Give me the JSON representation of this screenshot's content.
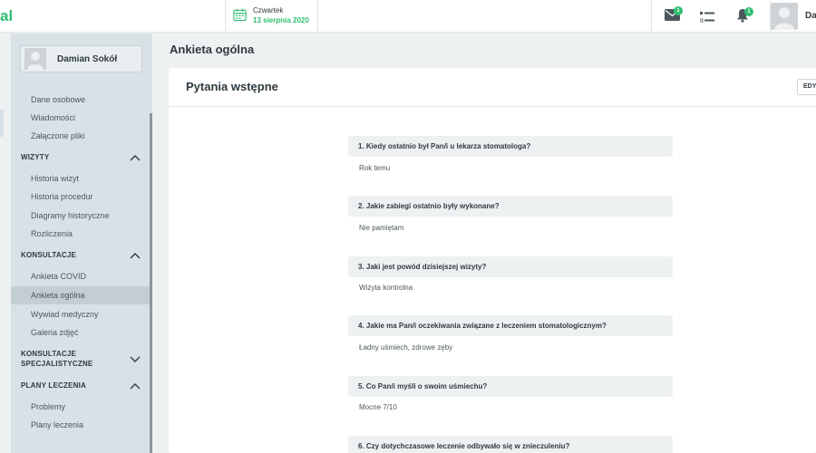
{
  "app": {
    "logo_text": "al"
  },
  "topbar": {
    "date_day": "Czwartek",
    "date_full": "13 sierpnia 2020",
    "mail_badge": "1",
    "bell_badge": "1",
    "user_name_partial": "Da"
  },
  "sidebar": {
    "profile_name": "Damian Sokół",
    "top_items": [
      "Dane osobowe",
      "Wiadomości",
      "Załączone pliki"
    ],
    "sections": [
      {
        "title": "WIZYTY",
        "expanded": true,
        "items": [
          "Historia wizyt",
          "Historia procedur",
          "Diagramy historyczne",
          "Rozliczenia"
        ]
      },
      {
        "title": "KONSULTACJE",
        "expanded": true,
        "items": [
          "Ankieta COVID",
          "Ankieta ogólna",
          "Wywiad medyczny",
          "Galeria zdjęć"
        ]
      },
      {
        "title_line1": "KONSULTACJE",
        "title_line2": "SPECJALISTYCZNE",
        "expanded": false
      },
      {
        "title": "PLANY LECZENIA",
        "expanded": true,
        "items": [
          "Problemy",
          "Plany leczenia"
        ]
      }
    ],
    "active_item": "Ankieta ogólna"
  },
  "main": {
    "page_title": "Ankieta ogólna",
    "card_title": "Pytania wstępne",
    "edit_label": "EDY",
    "questions": [
      {
        "q": "1. Kiedy ostatnio był Pan/i u lekarza stomatologa?",
        "a": "Rok temu"
      },
      {
        "q": "2. Jakie zabiegi ostatnio były wykonane?",
        "a": "Nie pamiętam"
      },
      {
        "q": "3. Jaki jest powód dzisiejszej wizyty?",
        "a": "Wizyta kontrolna"
      },
      {
        "q": "4. Jakie ma Pan/i oczekiwania związane z leczeniem stomatologicznym?",
        "a": "Ładny uśmiech, zdrowe zęby"
      },
      {
        "q": "5. Co Pan/i myśli o swoim uśmiechu?",
        "a": "Mocne 7/10"
      },
      {
        "q": "6. Czy dotychczasowe leczenie odbywało się w znieczuleniu?",
        "a": ""
      }
    ]
  },
  "colors": {
    "accent": "#2fbf71",
    "sidebar_bg": "#d8e2e6",
    "active_item_bg": "#c3ced3",
    "page_bg": "#eef1f2"
  }
}
